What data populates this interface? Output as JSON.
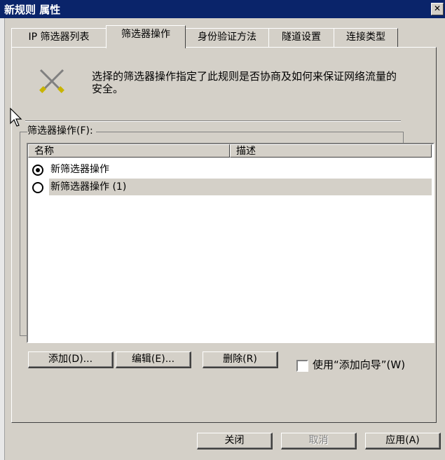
{
  "window": {
    "title": "新规则 属性",
    "close_label": "✕"
  },
  "tabs": [
    {
      "label": "IP 筛选器列表",
      "active": false
    },
    {
      "label": "筛选器操作",
      "active": true
    },
    {
      "label": "身份验证方法",
      "active": false
    },
    {
      "label": "隧道设置",
      "active": false
    },
    {
      "label": "连接类型",
      "active": false
    }
  ],
  "panel": {
    "icon": "tools-icon",
    "description": "选择的筛选器操作指定了此规则是否协商及如何来保证网络流量的安全。",
    "section_label": "筛选器操作(F):"
  },
  "list": {
    "columns": [
      "名称",
      "描述"
    ],
    "rows": [
      {
        "name": "新筛选器操作",
        "checked": true
      },
      {
        "name": "新筛选器操作 (1)",
        "checked": false
      }
    ]
  },
  "actions": {
    "add": "添加(D)...",
    "edit": "编辑(E)...",
    "remove": "删除(R)",
    "wizard_label": "使用“添加向导”(W)",
    "wizard_checked": false
  },
  "footer": {
    "close": "关闭",
    "cancel": "取消",
    "apply": "应用(A)"
  }
}
